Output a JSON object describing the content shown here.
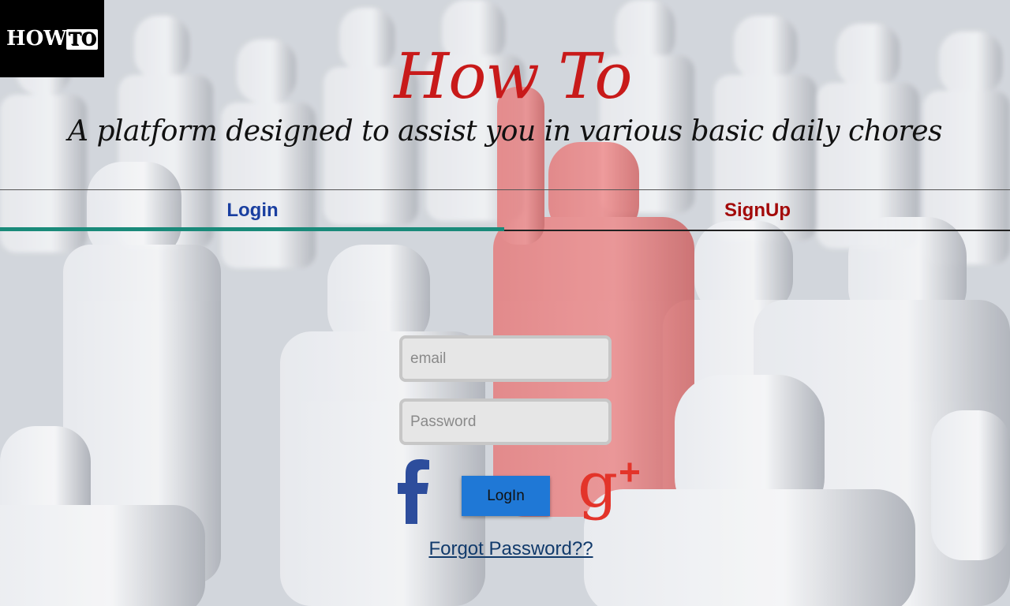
{
  "logo": {
    "text_how": "HOW",
    "text_to": "TO"
  },
  "hero": {
    "title": "How To",
    "subtitle": "A platform designed to assist you in various basic daily chores"
  },
  "tabs": [
    {
      "label": "Login",
      "active": true
    },
    {
      "label": "SignUp",
      "active": false
    }
  ],
  "form": {
    "email_placeholder": "email",
    "password_placeholder": "Password",
    "login_label": "LogIn",
    "forgot_label": "Forgot Password??"
  },
  "social": {
    "facebook_icon": "facebook-icon",
    "google_icon": "google-plus-icon"
  },
  "colors": {
    "title_red": "#c81a1a",
    "login_tab_blue": "#1a3fa0",
    "signup_tab_red": "#a30a0a",
    "tab_indicator": "#1a8a7a",
    "login_button": "#1f78d6",
    "facebook_blue": "#2d4d9c",
    "google_red": "#e3342a"
  }
}
